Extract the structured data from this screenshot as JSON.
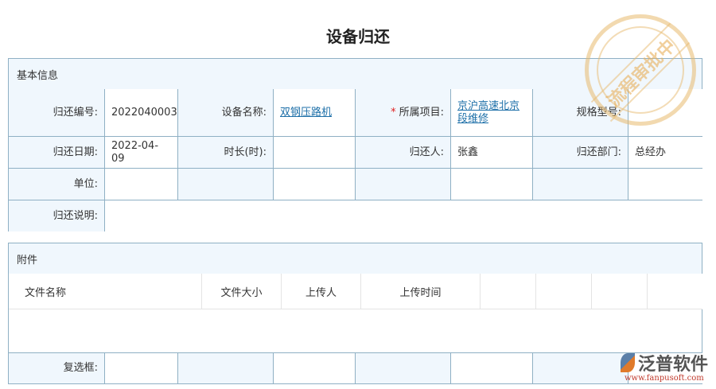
{
  "title": "设备归还",
  "basic": {
    "section_label": "基本信息",
    "return_no_label": "归还编号:",
    "return_no": "2022040003",
    "device_name_label": "设备名称:",
    "device_name": "双钢压路机",
    "project_label": "所属项目:",
    "project": "京沪高速北京段维修",
    "spec_label": "规格型号:",
    "spec": "",
    "return_date_label": "归还日期:",
    "return_date": "2022-04-09",
    "duration_label": "时长(时):",
    "duration": "",
    "returner_label": "归还人:",
    "returner": "张鑫",
    "dept_label": "归还部门:",
    "dept": "总经办",
    "unit_label": "单位:",
    "note_label": "归还说明:",
    "note": ""
  },
  "attachments": {
    "section_label": "附件",
    "columns": [
      "文件名称",
      "文件大小",
      "上传人",
      "上传时间"
    ],
    "checkbox_label": "复选框:"
  },
  "stamp": {
    "text": "流程审批中",
    "color": "#e8b96e"
  },
  "logo": {
    "name": "泛普软件",
    "url": "www.fanpusoft.com"
  }
}
